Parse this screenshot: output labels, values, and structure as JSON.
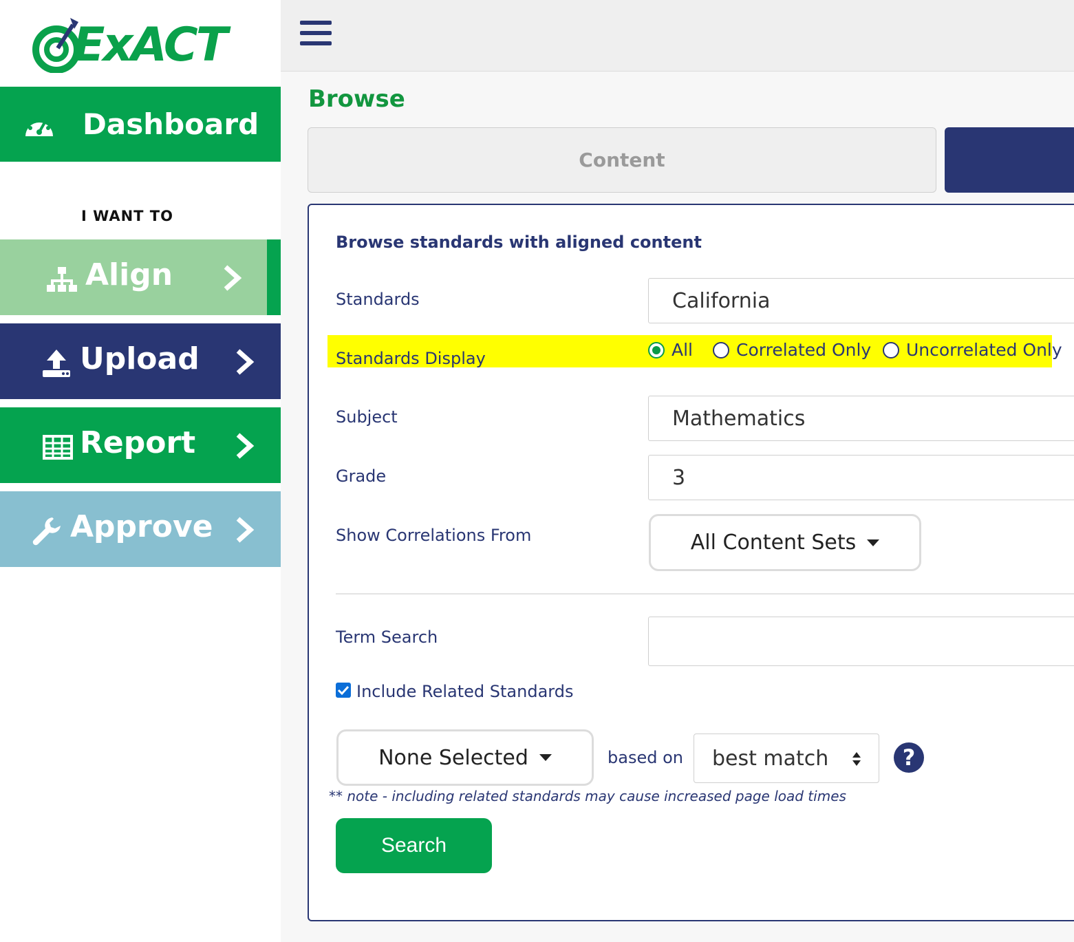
{
  "brand": {
    "name": "ExACT",
    "green": "#05a34f",
    "navy": "#293673"
  },
  "sidebar": {
    "dashboard_label": "Dashboard",
    "section_title": "I WANT TO",
    "items": [
      {
        "label": "Align",
        "icon": "sitemap-icon"
      },
      {
        "label": "Upload",
        "icon": "upload-icon"
      },
      {
        "label": "Report",
        "icon": "table-icon"
      },
      {
        "label": "Approve",
        "icon": "wrench-icon"
      }
    ]
  },
  "page": {
    "title": "Browse",
    "tabs": [
      {
        "label": "Content"
      },
      {
        "label": ""
      }
    ]
  },
  "form": {
    "heading": "Browse standards with aligned content",
    "standards": {
      "label": "Standards",
      "value": "California"
    },
    "standards_display": {
      "label": "Standards Display",
      "options": [
        "All",
        "Correlated Only",
        "Uncorrelated Only"
      ],
      "selected": "All"
    },
    "subject": {
      "label": "Subject",
      "value": "Mathematics"
    },
    "grade": {
      "label": "Grade",
      "value": "3"
    },
    "show_correlations": {
      "label": "Show Correlations From",
      "value": "All Content Sets"
    },
    "term_search": {
      "label": "Term Search",
      "value": ""
    },
    "include_related": {
      "label": "Include Related Standards",
      "checked": true
    },
    "related_select": {
      "value": "None Selected"
    },
    "based_on": {
      "label": "based on",
      "value": "best match"
    },
    "help_symbol": "?",
    "note": "** note - including related standards may cause increased page load times",
    "search_label": "Search"
  }
}
